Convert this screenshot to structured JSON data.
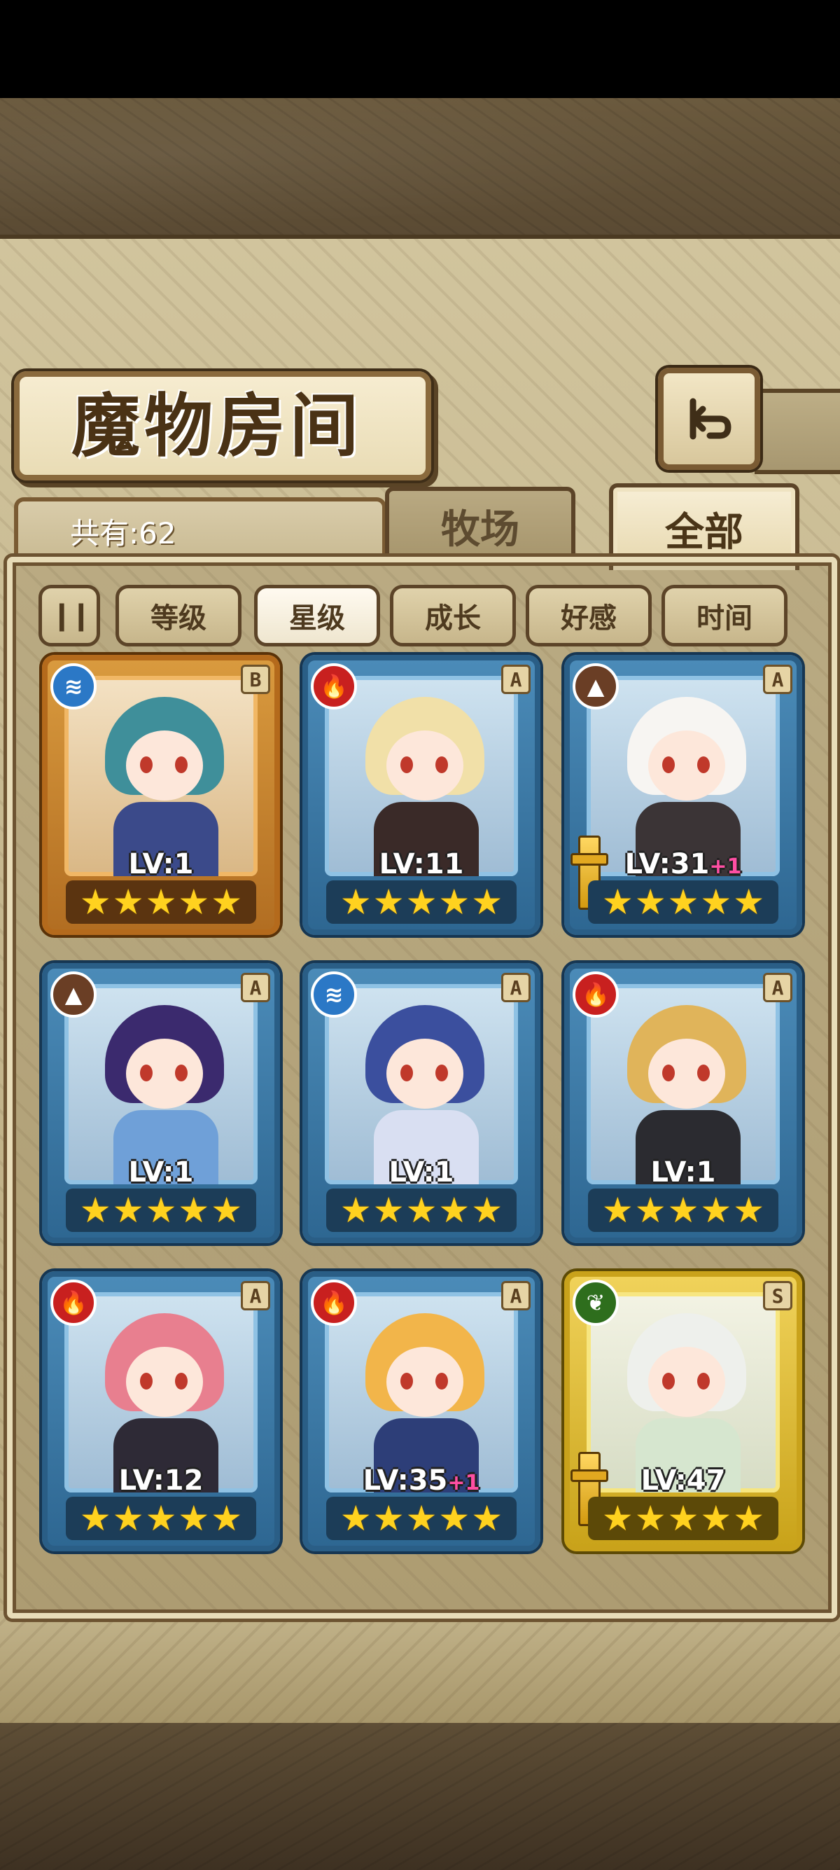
{
  "screen": {
    "title": "魔物房间",
    "count_label": "共有:62"
  },
  "tabs": [
    {
      "label": "牧场",
      "active": false
    },
    {
      "label": "全部",
      "active": true
    }
  ],
  "filters": {
    "sort_icon": "pause-sort-icon",
    "items": [
      {
        "label": "等级",
        "active": false
      },
      {
        "label": "星级",
        "active": true
      },
      {
        "label": "成长",
        "active": false
      },
      {
        "label": "好感",
        "active": false
      },
      {
        "label": "时间",
        "active": false
      }
    ]
  },
  "monsters": [
    {
      "element": "water",
      "rank": "B",
      "level": "LV:1",
      "plus": "",
      "stars": 5,
      "hair": "#3f8f9a",
      "body": "#3b4a8a",
      "weapon": false
    },
    {
      "element": "fire",
      "rank": "A",
      "level": "LV:11",
      "plus": "",
      "stars": 5,
      "hair": "#f1e0a8",
      "body": "#3a2a28",
      "weapon": false
    },
    {
      "element": "earth",
      "rank": "A",
      "level": "LV:31",
      "plus": "+1",
      "stars": 5,
      "hair": "#f7f5f2",
      "body": "#3b3436",
      "weapon": true
    },
    {
      "element": "earth",
      "rank": "A",
      "level": "LV:1",
      "plus": "",
      "stars": 5,
      "hair": "#3b2a6e",
      "body": "#6fa0d8",
      "weapon": false
    },
    {
      "element": "water",
      "rank": "A",
      "level": "LV:1",
      "plus": "",
      "stars": 5,
      "hair": "#3b4f9e",
      "body": "#d9dff2",
      "weapon": false
    },
    {
      "element": "fire",
      "rank": "A",
      "level": "LV:1",
      "plus": "",
      "stars": 5,
      "hair": "#e0b45a",
      "body": "#2b2b30",
      "weapon": false
    },
    {
      "element": "fire",
      "rank": "A",
      "level": "LV:12",
      "plus": "",
      "stars": 5,
      "hair": "#e87f8f",
      "body": "#2e2a36",
      "weapon": false
    },
    {
      "element": "fire",
      "rank": "A",
      "level": "LV:35",
      "plus": "+1",
      "stars": 5,
      "hair": "#f2b54a",
      "body": "#2d3e78",
      "weapon": false
    },
    {
      "element": "wind",
      "rank": "S",
      "level": "LV:47",
      "plus": "",
      "stars": 5,
      "hair": "#eef0ec",
      "body": "#d6e6cf",
      "weapon": true
    }
  ],
  "colors": {
    "panel": "#c8ba92",
    "frame_dark": "#5c4428",
    "star": "#ffd21f",
    "plus": "#ff4fa3"
  }
}
